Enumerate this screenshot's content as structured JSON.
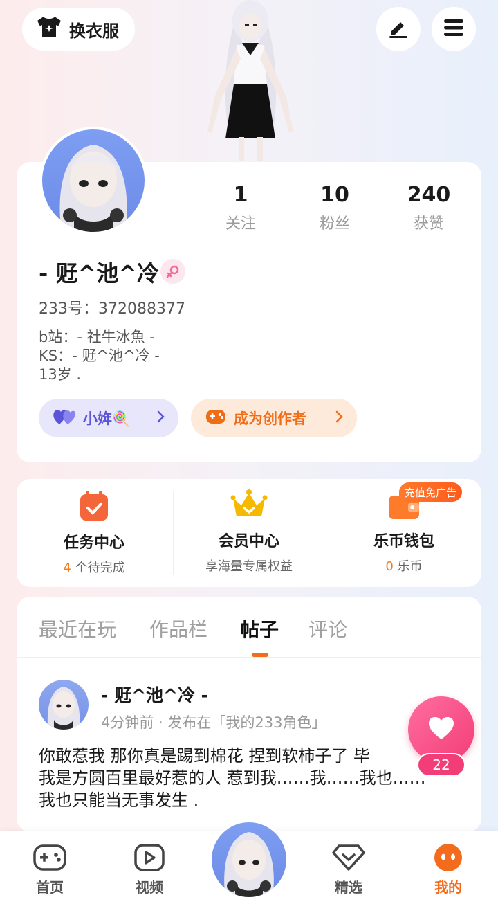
{
  "top_bar": {
    "outfit_label": "换衣服"
  },
  "profile": {
    "stats": [
      {
        "value": "1",
        "label": "关注"
      },
      {
        "value": "10",
        "label": "粉丝"
      },
      {
        "value": "240",
        "label": "获赞"
      }
    ],
    "username": "- 觃^池^冷 -",
    "id_line": "233号：372088377",
    "bio_lines": [
      "b站：- 社牛冰魚 -",
      "KS：- 觃^池^冷 -",
      "13岁 ."
    ],
    "pill_purple": "小姩🍭",
    "pill_orange": "成为创作者"
  },
  "centers": [
    {
      "title": "任务中心",
      "count": "4",
      "sub": " 个待完成"
    },
    {
      "title": "会员中心",
      "count": "",
      "sub": "享海量专属权益"
    },
    {
      "title": "乐币钱包",
      "count": "0",
      "sub": " 乐币"
    }
  ],
  "recharge_badge": "充值免广告",
  "tabs": [
    "最近在玩",
    "作品栏",
    "帖子",
    "评论"
  ],
  "active_tab": "帖子",
  "post": {
    "author": "- 觃^池^冷 -",
    "meta": "4分钟前 · 发布在「我的233角色」",
    "body_lines": [
      "你敢惹我 那你真是踢到棉花 捏到软柿子了 毕",
      "我是方圆百里最好惹的人 惹到我……我……我也……",
      "我也只能当无事发生 ."
    ]
  },
  "like": {
    "count": "22"
  },
  "bottom_nav": [
    {
      "label": "首页",
      "icon": "gamepad-icon"
    },
    {
      "label": "视频",
      "icon": "video-play-icon"
    },
    {
      "label": "精选",
      "icon": "heart-box-icon"
    },
    {
      "label": "我的",
      "icon": "face-icon"
    }
  ],
  "colors": {
    "accent": "#f36b1c",
    "purple": "#5a55d6",
    "like": "#f33d78"
  }
}
